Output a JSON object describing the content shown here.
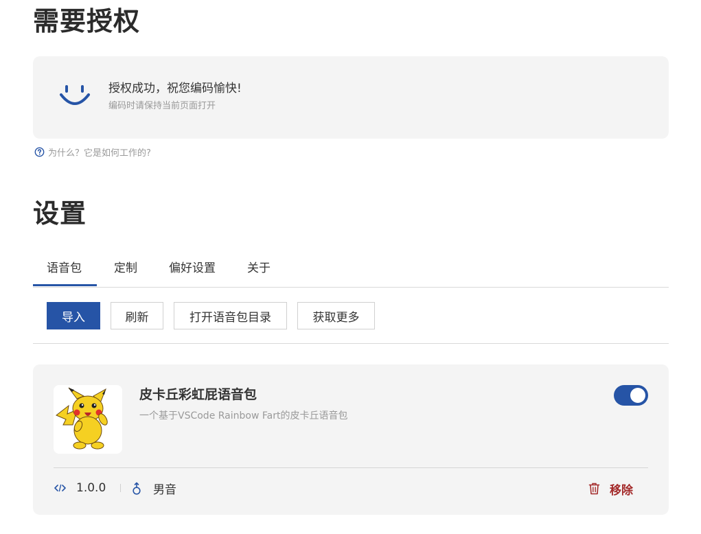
{
  "auth": {
    "heading": "需要授权",
    "success_title": "授权成功，祝您编码愉快!",
    "success_subtitle": "编码时请保持当前页面打开",
    "help_link": "为什么？它是如何工作的?"
  },
  "settings": {
    "heading": "设置",
    "tabs": [
      {
        "label": "语音包",
        "active": true
      },
      {
        "label": "定制",
        "active": false
      },
      {
        "label": "偏好设置",
        "active": false
      },
      {
        "label": "关于",
        "active": false
      }
    ],
    "buttons": {
      "import": "导入",
      "refresh": "刷新",
      "open_dir": "打开语音包目录",
      "get_more": "获取更多"
    }
  },
  "packs": [
    {
      "name": "皮卡丘彩虹屁语音包",
      "description": "一个基于VSCode Rainbow Fart的皮卡丘语音包",
      "enabled": true,
      "version": "1.0.0",
      "gender": "男音",
      "remove_label": "移除"
    }
  ],
  "colors": {
    "accent": "#2654a6",
    "danger": "#a32a2a",
    "card_bg": "#f4f4f4"
  },
  "icons": [
    "smile-icon",
    "help-circle-icon",
    "code-icon",
    "male-icon",
    "trash-icon",
    "pikachu-image"
  ]
}
